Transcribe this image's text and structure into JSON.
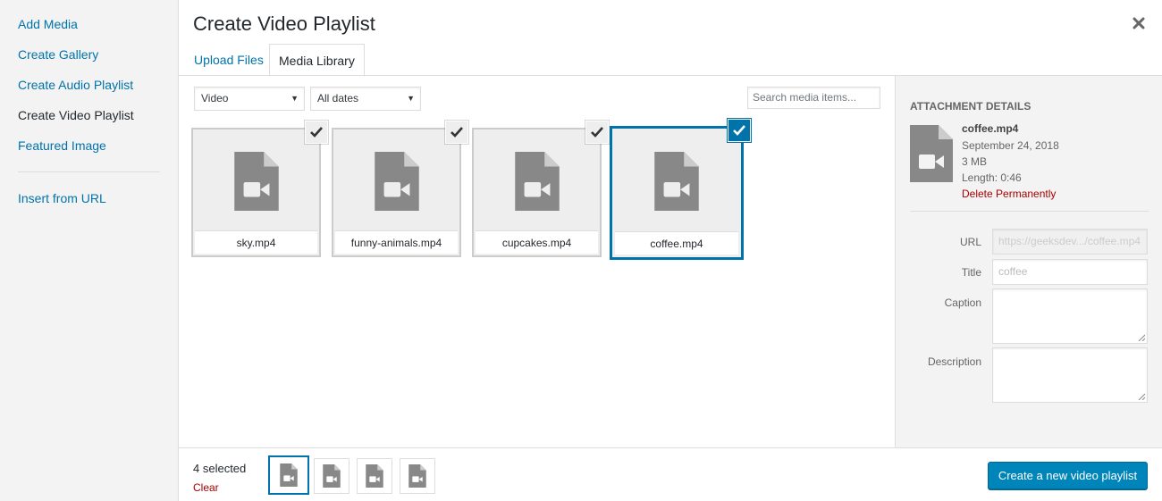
{
  "sidebar": {
    "items": [
      {
        "label": "Add Media"
      },
      {
        "label": "Create Gallery"
      },
      {
        "label": "Create Audio Playlist"
      },
      {
        "label": "Create Video Playlist"
      },
      {
        "label": "Featured Image"
      },
      {
        "label": "Insert from URL"
      }
    ]
  },
  "header": {
    "title": "Create Video Playlist",
    "close_icon": "close-icon"
  },
  "tabs": [
    {
      "label": "Upload Files"
    },
    {
      "label": "Media Library"
    }
  ],
  "filters": {
    "type_selected": "Video",
    "date_selected": "All dates",
    "search_placeholder": "Search media items..."
  },
  "attachments": [
    {
      "filename": "sky.mp4",
      "selected": true
    },
    {
      "filename": "funny-animals.mp4",
      "selected": true
    },
    {
      "filename": "cupcakes.mp4",
      "selected": true
    },
    {
      "filename": "coffee.mp4",
      "selected": true,
      "current": true
    }
  ],
  "details": {
    "heading": "ATTACHMENT DETAILS",
    "filename": "coffee.mp4",
    "date": "September 24, 2018",
    "size": "3 MB",
    "length": "Length: 0:46",
    "delete_label": "Delete Permanently",
    "url_label": "URL",
    "url_value": "https://geeksdev.../coffee.mp4",
    "title_label": "Title",
    "title_value": "coffee",
    "caption_label": "Caption",
    "description_label": "Description"
  },
  "toolbar": {
    "selected_count": "4 selected",
    "clear_label": "Clear",
    "create_button": "Create a new video playlist"
  },
  "colors": {
    "accent": "#0073aa",
    "button": "#0085ba",
    "danger": "#a00"
  }
}
